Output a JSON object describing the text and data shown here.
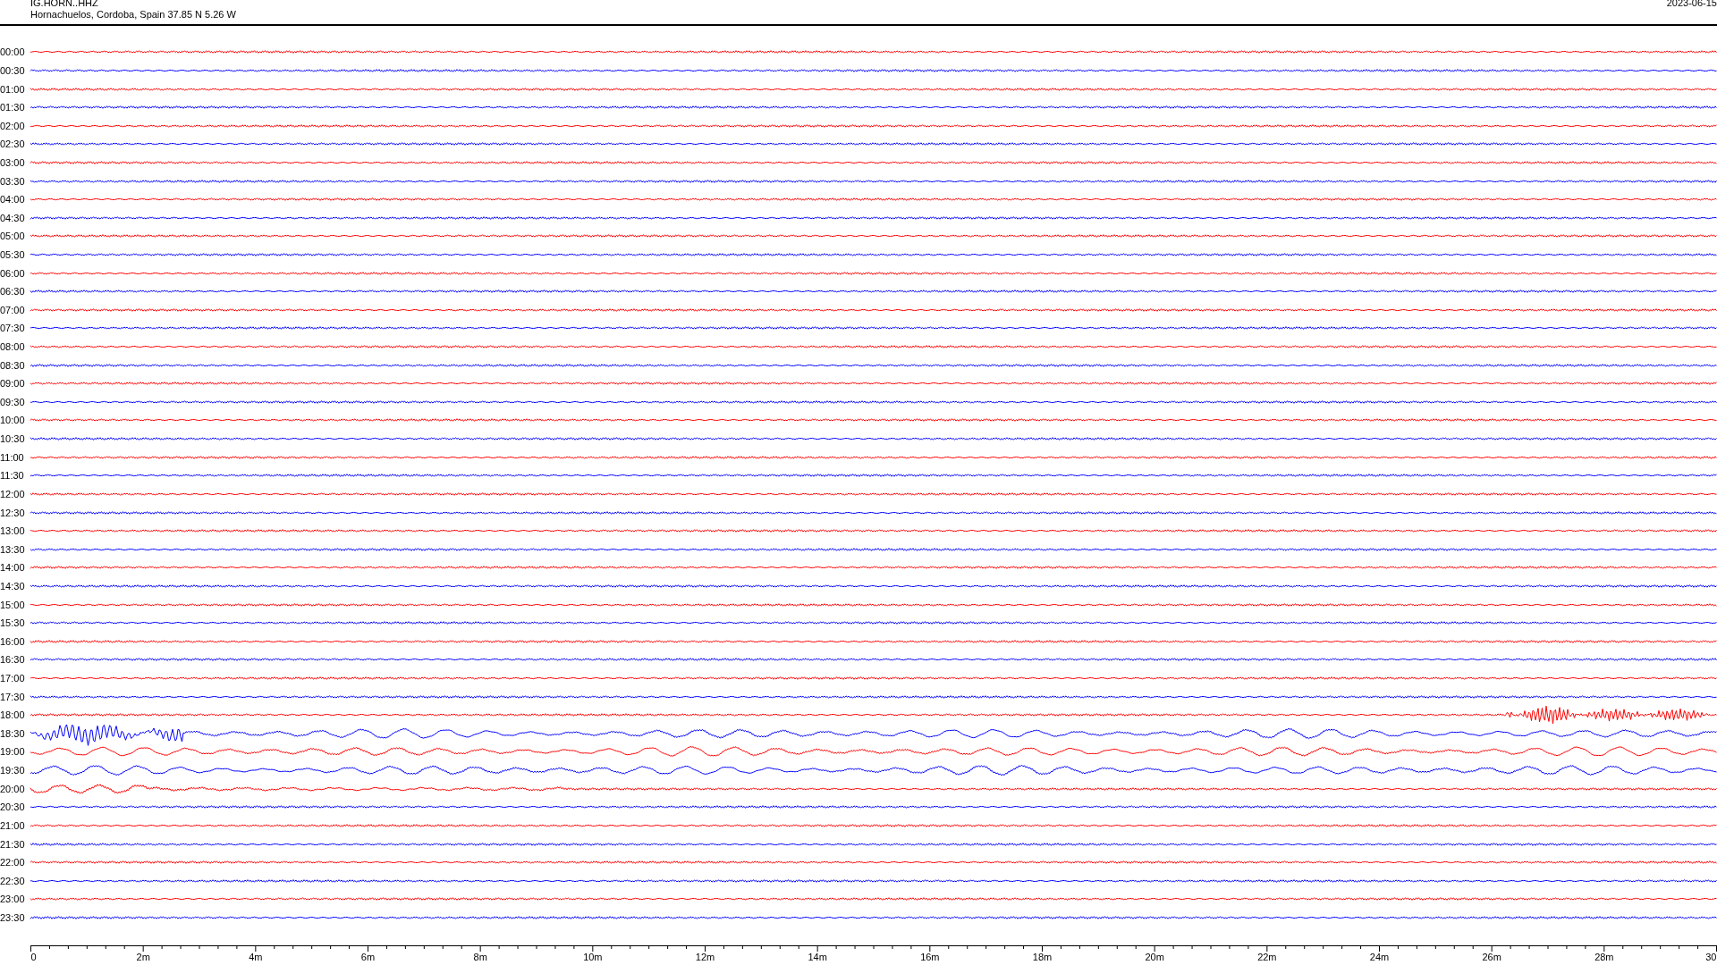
{
  "header": {
    "station": "IG.HORN..HHZ",
    "location": "Hornachuelos, Cordoba, Spain  37.85 N 5.26 W",
    "date": "2023-06-15"
  },
  "traces": [
    {
      "time": "00:00",
      "color": "#ff0000",
      "kind": "quiet"
    },
    {
      "time": "00:30",
      "color": "#0000ff",
      "kind": "quiet"
    },
    {
      "time": "01:00",
      "color": "#ff0000",
      "kind": "quiet"
    },
    {
      "time": "01:30",
      "color": "#0000ff",
      "kind": "quiet"
    },
    {
      "time": "02:00",
      "color": "#ff0000",
      "kind": "quiet"
    },
    {
      "time": "02:30",
      "color": "#0000ff",
      "kind": "quiet"
    },
    {
      "time": "03:00",
      "color": "#ff0000",
      "kind": "quiet"
    },
    {
      "time": "03:30",
      "color": "#0000ff",
      "kind": "quiet"
    },
    {
      "time": "04:00",
      "color": "#ff0000",
      "kind": "quiet"
    },
    {
      "time": "04:30",
      "color": "#0000ff",
      "kind": "quiet"
    },
    {
      "time": "05:00",
      "color": "#ff0000",
      "kind": "quiet"
    },
    {
      "time": "05:30",
      "color": "#0000ff",
      "kind": "quiet"
    },
    {
      "time": "06:00",
      "color": "#ff0000",
      "kind": "quiet"
    },
    {
      "time": "06:30",
      "color": "#0000ff",
      "kind": "quiet"
    },
    {
      "time": "07:00",
      "color": "#ff0000",
      "kind": "quiet"
    },
    {
      "time": "07:30",
      "color": "#0000ff",
      "kind": "quiet"
    },
    {
      "time": "08:00",
      "color": "#ff0000",
      "kind": "quiet"
    },
    {
      "time": "08:30",
      "color": "#0000ff",
      "kind": "quiet"
    },
    {
      "time": "09:00",
      "color": "#ff0000",
      "kind": "quiet"
    },
    {
      "time": "09:30",
      "color": "#0000ff",
      "kind": "quiet"
    },
    {
      "time": "10:00",
      "color": "#ff0000",
      "kind": "quiet"
    },
    {
      "time": "10:30",
      "color": "#0000ff",
      "kind": "quiet"
    },
    {
      "time": "11:00",
      "color": "#ff0000",
      "kind": "quiet"
    },
    {
      "time": "11:30",
      "color": "#0000ff",
      "kind": "quiet"
    },
    {
      "time": "12:00",
      "color": "#ff0000",
      "kind": "quiet"
    },
    {
      "time": "12:30",
      "color": "#0000ff",
      "kind": "quiet"
    },
    {
      "time": "13:00",
      "color": "#ff0000",
      "kind": "quiet"
    },
    {
      "time": "13:30",
      "color": "#0000ff",
      "kind": "quiet"
    },
    {
      "time": "14:00",
      "color": "#ff0000",
      "kind": "quiet"
    },
    {
      "time": "14:30",
      "color": "#0000ff",
      "kind": "quiet"
    },
    {
      "time": "15:00",
      "color": "#ff0000",
      "kind": "quiet"
    },
    {
      "time": "15:30",
      "color": "#0000ff",
      "kind": "quiet"
    },
    {
      "time": "16:00",
      "color": "#ff0000",
      "kind": "quiet"
    },
    {
      "time": "16:30",
      "color": "#0000ff",
      "kind": "quiet"
    },
    {
      "time": "17:00",
      "color": "#ff0000",
      "kind": "quiet"
    },
    {
      "time": "17:30",
      "color": "#0000ff",
      "kind": "quiet"
    },
    {
      "time": "18:00",
      "color": "#ff0000",
      "kind": "burst"
    },
    {
      "time": "18:30",
      "color": "#0000ff",
      "kind": "strong"
    },
    {
      "time": "19:00",
      "color": "#ff0000",
      "kind": "strong"
    },
    {
      "time": "19:30",
      "color": "#0000ff",
      "kind": "strong"
    },
    {
      "time": "20:00",
      "color": "#ff0000",
      "kind": "swell"
    },
    {
      "time": "20:30",
      "color": "#0000ff",
      "kind": "quiet"
    },
    {
      "time": "21:00",
      "color": "#ff0000",
      "kind": "quiet"
    },
    {
      "time": "21:30",
      "color": "#0000ff",
      "kind": "quiet"
    },
    {
      "time": "22:00",
      "color": "#ff0000",
      "kind": "quiet"
    },
    {
      "time": "22:30",
      "color": "#0000ff",
      "kind": "quiet"
    },
    {
      "time": "23:00",
      "color": "#ff0000",
      "kind": "quiet"
    },
    {
      "time": "23:30",
      "color": "#0000ff",
      "kind": "quiet"
    }
  ],
  "axis": {
    "ticks": [
      "0",
      "2m",
      "4m",
      "6m",
      "8m",
      "10m",
      "12m",
      "14m",
      "16m",
      "18m",
      "20m",
      "22m",
      "24m",
      "26m",
      "28m",
      "30"
    ]
  }
}
